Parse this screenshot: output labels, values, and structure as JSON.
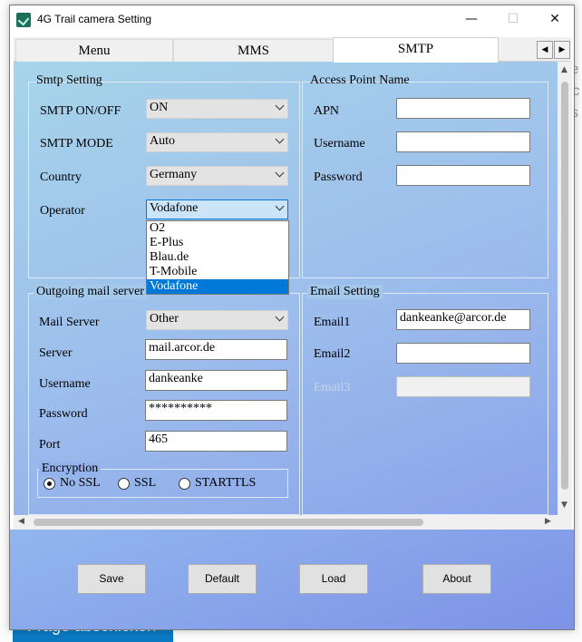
{
  "background": {
    "right_fragments": [
      "le",
      "ic",
      "s"
    ],
    "bottom_button": "Frage abschicken"
  },
  "window": {
    "title": "4G Trail camera Setting",
    "controls": {
      "minimize": "—",
      "maximize": "☐",
      "close": "✕"
    }
  },
  "tabs": [
    {
      "label": "Menu",
      "active": false
    },
    {
      "label": "MMS",
      "active": false
    },
    {
      "label": "SMTP",
      "active": true
    }
  ],
  "tab_nav": {
    "prev": "◀",
    "next": "▶"
  },
  "smtp_setting": {
    "legend": "Smtp Setting",
    "on_off": {
      "label": "SMTP ON/OFF",
      "value": "ON"
    },
    "mode": {
      "label": "SMTP MODE",
      "value": "Auto"
    },
    "country": {
      "label": "Country",
      "value": "Germany"
    },
    "operator": {
      "label": "Operator",
      "value": "Vodafone",
      "options": [
        "O2",
        "E-Plus",
        "Blau.de",
        "T-Mobile",
        "Vodafone"
      ],
      "selected_index": 4
    }
  },
  "apn": {
    "legend": "Access Point Name",
    "apn_label": "APN",
    "apn_value": "",
    "username_label": "Username",
    "username_value": "",
    "password_label": "Password",
    "password_value": ""
  },
  "outgoing": {
    "legend": "Outgoing mail server",
    "mail_server": {
      "label": "Mail Server",
      "value": "Other"
    },
    "server": {
      "label": "Server",
      "value": "mail.arcor.de"
    },
    "username": {
      "label": "Username",
      "value": "dankeanke"
    },
    "password": {
      "label": "Password",
      "value": "**********"
    },
    "port": {
      "label": "Port",
      "value": "465"
    },
    "encryption": {
      "legend": "Encryption",
      "options": [
        "No SSL",
        "SSL",
        "STARTTLS"
      ],
      "selected": "No SSL"
    }
  },
  "email": {
    "legend": "Email Setting",
    "email1_label": "Email1",
    "email1_value": "dankeanke@arcor.de",
    "email2_label": "Email2",
    "email2_value": "",
    "email3_label": "Email3",
    "email3_value": ""
  },
  "buttons": {
    "save": "Save",
    "default": "Default",
    "load": "Load",
    "about": "About"
  },
  "scroll": {
    "up": "▲",
    "down": "▼",
    "left": "◀",
    "right": "▶"
  }
}
